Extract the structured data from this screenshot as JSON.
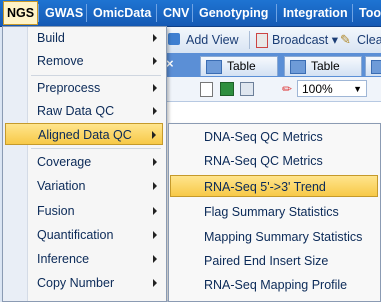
{
  "menubar": {
    "items": [
      "NGS",
      "GWAS",
      "OmicData",
      "CNV",
      "Genotyping",
      "Integration",
      "Tool"
    ]
  },
  "toolbar": {
    "add_view": "Add View",
    "broadcast": "Broadcast",
    "clear": "Clea"
  },
  "tabs": [
    "Table",
    "Table"
  ],
  "zoom": {
    "value": "100%"
  },
  "ngs_menu": {
    "items": [
      "Build",
      "Remove",
      "Preprocess",
      "Raw Data QC",
      "Aligned Data QC",
      "Coverage",
      "Variation",
      "Fusion",
      "Quantification",
      "Inference",
      "Copy Number"
    ],
    "highlighted": "Aligned Data QC"
  },
  "aligned_qc_submenu": {
    "items": [
      "DNA-Seq QC Metrics",
      "RNA-Seq QC Metrics",
      "RNA-Seq 5'->3' Trend",
      "Flag Summary Statistics",
      "Mapping Summary Statistics",
      "Paired End Insert Size",
      "RNA-Seq Mapping Profile"
    ],
    "highlighted": "RNA-Seq 5'->3' Trend"
  },
  "colors": {
    "menubar": "#1e74d2",
    "highlight": "#f7c948"
  }
}
